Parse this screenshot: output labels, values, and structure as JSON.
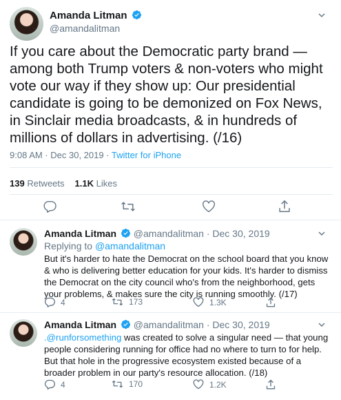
{
  "main_tweet": {
    "author_name": "Amanda Litman",
    "handle": "@amandalitman",
    "text": "If you care about the Democratic party brand — among both Trump voters & non-voters who might vote our way if they show up: Our presidential candidate is going to be demonized on Fox News, in Sinclair media broadcasts, & in hundreds of millions of dollars in advertising. (/16)",
    "timestamp": "9:08 AM · Dec 30, 2019 · ",
    "source": "Twitter for iPhone",
    "retweets_count": "139",
    "retweets_label": "Retweets",
    "likes_count": "1.1K",
    "likes_label": "Likes"
  },
  "replies": [
    {
      "author_name": "Amanda Litman",
      "handle": "@amandalitman",
      "date": "· Dec 30, 2019",
      "replying_label": "Replying to ",
      "replying_to": "@amandalitman",
      "mention": "",
      "text": "But it's harder to hate the Democrat on the school board that you know & who is delivering better education for your kids. It's harder to dismiss the Democrat on the city council who's from the neighborhood, gets your problems, & makes sure the city is running smoothly. (/17)",
      "reply_count": "4",
      "retweet_count": "173",
      "like_count": "1.3K"
    },
    {
      "author_name": "Amanda Litman",
      "handle": "@amandalitman",
      "date": "· Dec 30, 2019",
      "mention": ".@runforsomething",
      "text": " was created to solve a singular need — that young people considering running for office had no where to turn to for help. But that hole in the progressive ecosystem existed because of a broader problem in our party's resource allocation. (/18)",
      "reply_count": "4",
      "retweet_count": "170",
      "like_count": "1.2K"
    }
  ],
  "colors": {
    "link": "#1da1f2",
    "secondary_text": "#657786",
    "divider": "#e6ecf0"
  }
}
